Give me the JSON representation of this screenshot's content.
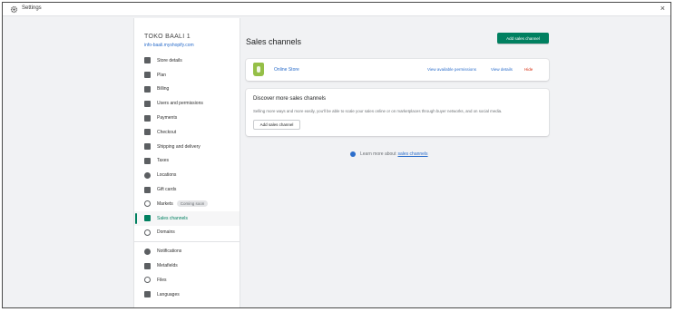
{
  "window": {
    "title": "Settings",
    "close_glyph": "×"
  },
  "sidebar": {
    "store_name": "TOKO BAALI 1",
    "store_url": "info-baali.myshopify.com",
    "items": [
      {
        "label": "Store details",
        "icon": "store-icon"
      },
      {
        "label": "Plan",
        "icon": "plan-icon"
      },
      {
        "label": "Billing",
        "icon": "billing-icon"
      },
      {
        "label": "Users and permissions",
        "icon": "users-icon"
      },
      {
        "label": "Payments",
        "icon": "payments-icon"
      },
      {
        "label": "Checkout",
        "icon": "checkout-icon"
      },
      {
        "label": "Shipping and delivery",
        "icon": "shipping-icon"
      },
      {
        "label": "Taxes",
        "icon": "taxes-icon"
      },
      {
        "label": "Locations",
        "icon": "locations-icon"
      },
      {
        "label": "Gift cards",
        "icon": "gift-cards-icon"
      },
      {
        "label": "Markets",
        "icon": "markets-icon",
        "badge": "Coming soon"
      },
      {
        "label": "Sales channels",
        "icon": "sales-channels-icon",
        "active": true
      },
      {
        "label": "Domains",
        "icon": "domains-icon"
      },
      {
        "label": "Notifications",
        "icon": "notifications-icon"
      },
      {
        "label": "Metafields",
        "icon": "metafields-icon"
      },
      {
        "label": "Files",
        "icon": "files-icon"
      },
      {
        "label": "Languages",
        "icon": "languages-icon"
      }
    ]
  },
  "main": {
    "title": "Sales channels",
    "add_button": "Add sales channel",
    "online_store": {
      "name": "Online Store",
      "view_permissions": "View available permissions",
      "view_details": "View details",
      "hide_pin": "Hide"
    },
    "discover": {
      "title": "Discover more sales channels",
      "text": "Selling more ways and more easily, you'll be able to scale your sales online or on marketplaces through buyer networks, and on social media.",
      "button": "Add sales channel"
    },
    "learn_more": {
      "prefix": "Learn more about",
      "link": "sales channels"
    }
  },
  "colors": {
    "accent": "#008060",
    "link": "#2c6ecb",
    "danger": "#d72c0d",
    "shopify_green": "#95bf47"
  }
}
